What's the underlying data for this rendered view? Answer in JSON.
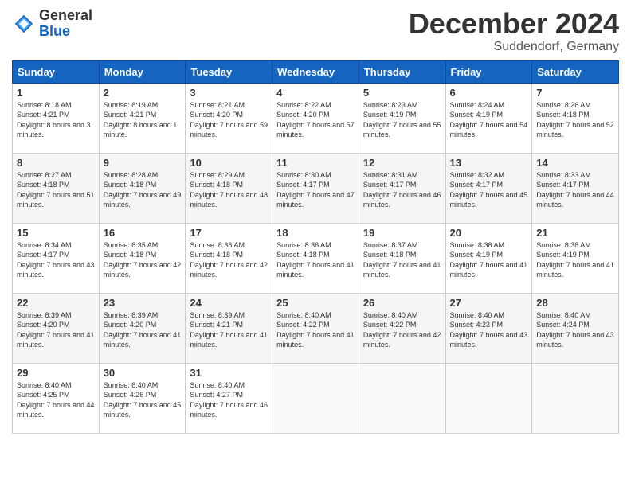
{
  "header": {
    "logo_general": "General",
    "logo_blue": "Blue",
    "month_title": "December 2024",
    "location": "Suddendorf, Germany"
  },
  "weekdays": [
    "Sunday",
    "Monday",
    "Tuesday",
    "Wednesday",
    "Thursday",
    "Friday",
    "Saturday"
  ],
  "weeks": [
    [
      {
        "day": "1",
        "sunrise": "8:18 AM",
        "sunset": "4:21 PM",
        "daylight": "8 hours and 3 minutes."
      },
      {
        "day": "2",
        "sunrise": "8:19 AM",
        "sunset": "4:21 PM",
        "daylight": "8 hours and 1 minute."
      },
      {
        "day": "3",
        "sunrise": "8:21 AM",
        "sunset": "4:20 PM",
        "daylight": "7 hours and 59 minutes."
      },
      {
        "day": "4",
        "sunrise": "8:22 AM",
        "sunset": "4:20 PM",
        "daylight": "7 hours and 57 minutes."
      },
      {
        "day": "5",
        "sunrise": "8:23 AM",
        "sunset": "4:19 PM",
        "daylight": "7 hours and 55 minutes."
      },
      {
        "day": "6",
        "sunrise": "8:24 AM",
        "sunset": "4:19 PM",
        "daylight": "7 hours and 54 minutes."
      },
      {
        "day": "7",
        "sunrise": "8:26 AM",
        "sunset": "4:18 PM",
        "daylight": "7 hours and 52 minutes."
      }
    ],
    [
      {
        "day": "8",
        "sunrise": "8:27 AM",
        "sunset": "4:18 PM",
        "daylight": "7 hours and 51 minutes."
      },
      {
        "day": "9",
        "sunrise": "8:28 AM",
        "sunset": "4:18 PM",
        "daylight": "7 hours and 49 minutes."
      },
      {
        "day": "10",
        "sunrise": "8:29 AM",
        "sunset": "4:18 PM",
        "daylight": "7 hours and 48 minutes."
      },
      {
        "day": "11",
        "sunrise": "8:30 AM",
        "sunset": "4:17 PM",
        "daylight": "7 hours and 47 minutes."
      },
      {
        "day": "12",
        "sunrise": "8:31 AM",
        "sunset": "4:17 PM",
        "daylight": "7 hours and 46 minutes."
      },
      {
        "day": "13",
        "sunrise": "8:32 AM",
        "sunset": "4:17 PM",
        "daylight": "7 hours and 45 minutes."
      },
      {
        "day": "14",
        "sunrise": "8:33 AM",
        "sunset": "4:17 PM",
        "daylight": "7 hours and 44 minutes."
      }
    ],
    [
      {
        "day": "15",
        "sunrise": "8:34 AM",
        "sunset": "4:17 PM",
        "daylight": "7 hours and 43 minutes."
      },
      {
        "day": "16",
        "sunrise": "8:35 AM",
        "sunset": "4:18 PM",
        "daylight": "7 hours and 42 minutes."
      },
      {
        "day": "17",
        "sunrise": "8:36 AM",
        "sunset": "4:18 PM",
        "daylight": "7 hours and 42 minutes."
      },
      {
        "day": "18",
        "sunrise": "8:36 AM",
        "sunset": "4:18 PM",
        "daylight": "7 hours and 41 minutes."
      },
      {
        "day": "19",
        "sunrise": "8:37 AM",
        "sunset": "4:18 PM",
        "daylight": "7 hours and 41 minutes."
      },
      {
        "day": "20",
        "sunrise": "8:38 AM",
        "sunset": "4:19 PM",
        "daylight": "7 hours and 41 minutes."
      },
      {
        "day": "21",
        "sunrise": "8:38 AM",
        "sunset": "4:19 PM",
        "daylight": "7 hours and 41 minutes."
      }
    ],
    [
      {
        "day": "22",
        "sunrise": "8:39 AM",
        "sunset": "4:20 PM",
        "daylight": "7 hours and 41 minutes."
      },
      {
        "day": "23",
        "sunrise": "8:39 AM",
        "sunset": "4:20 PM",
        "daylight": "7 hours and 41 minutes."
      },
      {
        "day": "24",
        "sunrise": "8:39 AM",
        "sunset": "4:21 PM",
        "daylight": "7 hours and 41 minutes."
      },
      {
        "day": "25",
        "sunrise": "8:40 AM",
        "sunset": "4:22 PM",
        "daylight": "7 hours and 41 minutes."
      },
      {
        "day": "26",
        "sunrise": "8:40 AM",
        "sunset": "4:22 PM",
        "daylight": "7 hours and 42 minutes."
      },
      {
        "day": "27",
        "sunrise": "8:40 AM",
        "sunset": "4:23 PM",
        "daylight": "7 hours and 43 minutes."
      },
      {
        "day": "28",
        "sunrise": "8:40 AM",
        "sunset": "4:24 PM",
        "daylight": "7 hours and 43 minutes."
      }
    ],
    [
      {
        "day": "29",
        "sunrise": "8:40 AM",
        "sunset": "4:25 PM",
        "daylight": "7 hours and 44 minutes."
      },
      {
        "day": "30",
        "sunrise": "8:40 AM",
        "sunset": "4:26 PM",
        "daylight": "7 hours and 45 minutes."
      },
      {
        "day": "31",
        "sunrise": "8:40 AM",
        "sunset": "4:27 PM",
        "daylight": "7 hours and 46 minutes."
      },
      null,
      null,
      null,
      null
    ]
  ]
}
